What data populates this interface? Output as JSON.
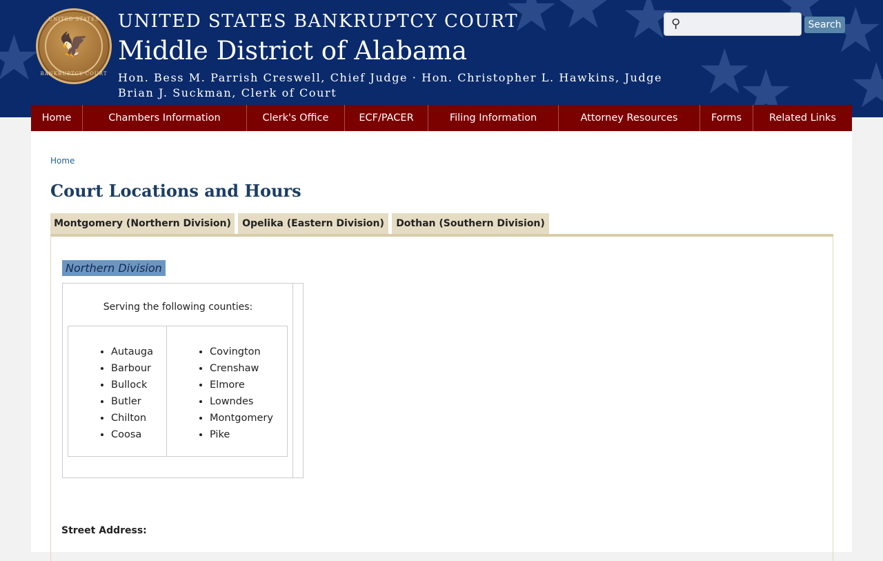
{
  "header": {
    "seal_text_top": "UNITED STATES",
    "seal_text_bottom": "BANKRUPTCY COURT",
    "line1": "UNITED STATES BANKRUPTCY COURT",
    "line2": "Middle District of Alabama",
    "line3": "Hon. Bess M. Parrish Creswell, Chief Judge · Hon. Christopher L. Hawkins, Judge",
    "line4": "Brian J. Suckman, Clerk of Court"
  },
  "search": {
    "icon": "magnifier-icon",
    "value": "",
    "button_label": "Search"
  },
  "nav": {
    "items": [
      {
        "label": "Home"
      },
      {
        "label": "Chambers Information"
      },
      {
        "label": "Clerk's Office"
      },
      {
        "label": "ECF/PACER"
      },
      {
        "label": "Filing Information"
      },
      {
        "label": "Attorney Resources"
      },
      {
        "label": "Forms"
      },
      {
        "label": "Related Links"
      }
    ]
  },
  "breadcrumb": {
    "home": "Home"
  },
  "page": {
    "title": "Court Locations and Hours"
  },
  "tabs": [
    {
      "label": "Montgomery (Northern Division)"
    },
    {
      "label": "Opelika (Eastern Division)"
    },
    {
      "label": "Dothan (Southern Division)"
    }
  ],
  "division": {
    "heading": "Northern Division",
    "serving_text": "Serving the following counties:",
    "counties_left": [
      "Autauga",
      "Barbour",
      "Bullock",
      "Butler",
      "Chilton",
      "Coosa"
    ],
    "counties_right": [
      "Covington",
      "Crenshaw",
      "Elmore",
      "Lowndes",
      "Montgomery",
      "Pike"
    ],
    "street_address_label": "Street Address:"
  },
  "colors": {
    "header_bg": "#0a2a6b",
    "nav_bg": "#7b0000",
    "tab_bg": "#e5dcc3",
    "highlight": "#6b96c2",
    "title_color": "#1c3d63"
  }
}
